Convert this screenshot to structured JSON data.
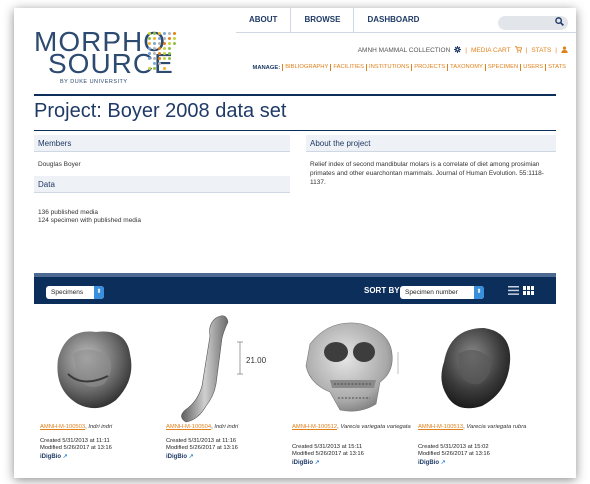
{
  "logo": {
    "line1": "MORPHO",
    "line2": "SOURCE",
    "sub": "BY DUKE UNIVERSITY"
  },
  "topnav": {
    "items": [
      "ABOUT",
      "BROWSE",
      "DASHBOARD"
    ]
  },
  "search": {
    "placeholder": ""
  },
  "collection_row": {
    "collection": "AMNH MAMMAL COLLECTION",
    "media_cart": "MEDIA CART",
    "stats": "STATS"
  },
  "manage": {
    "label": "MANAGE:",
    "links": [
      "BIBLIOGRAPHY",
      "FACILITIES",
      "INSTITUTIONS",
      "PROJECTS",
      "TAXONOMY",
      "SPECIMEN",
      "USERS",
      "STATS"
    ]
  },
  "project": {
    "title": "Project: Boyer 2008 data set",
    "members_heading": "Members",
    "member": "Douglas Boyer",
    "data_heading": "Data",
    "data_line1": "136 published media",
    "data_line2": "124 specimen with published media",
    "about_heading": "About the project",
    "about_text": "Relief index of second mandibular molars is a correlate of diet among prosimian primates and other euarchontan mammals. Journal of Human Evolution. 55:1118-1137."
  },
  "toolbar": {
    "view_select": "Specimens",
    "sort_label": "SORT BY",
    "sort_select": "Specimen number"
  },
  "cards": [
    {
      "number": "AMNH-M-100503",
      "species": "Indri indri",
      "created": "Created 5/31/2013 at 11:11",
      "modified": "Modified 5/26/2017 at 13:16",
      "idig": "iDigBio"
    },
    {
      "number": "AMNH-M-100504",
      "species": "Indri indri",
      "created": "Created 5/31/2013 at 11:16",
      "modified": "Modified 5/26/2017 at 13:16",
      "idig": "iDigBio",
      "scale": "21.00"
    },
    {
      "number": "AMNH-M-100512",
      "species": "Varecia variegata variegata",
      "created": "Created 5/31/2013 at 15:11",
      "modified": "Modified 5/26/2017 at 13:16",
      "idig": "iDigBio"
    },
    {
      "number": "AMNH-M-100513",
      "species": "Varecia variegata rubra",
      "created": "Created 5/31/2013 at 15:02",
      "modified": "Modified 5/26/2017 at 13:16",
      "idig": "iDigBio"
    }
  ],
  "colors": {
    "navy": "#0c2e5b",
    "orange": "#e0811b",
    "title_blue": "#1f3a66"
  }
}
